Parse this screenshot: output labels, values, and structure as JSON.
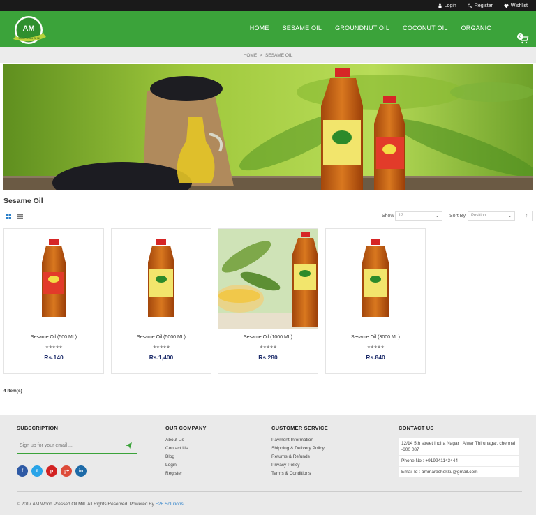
{
  "topbar": {
    "login": "Login",
    "register": "Register",
    "wishlist": "Wishlist"
  },
  "logo": {
    "text": "AM",
    "subtext": "Wood Pressed Oil Mill"
  },
  "nav": [
    {
      "label": "HOME"
    },
    {
      "label": "SESAME OIL"
    },
    {
      "label": "GROUNDNUT OIL"
    },
    {
      "label": "COCONUT OIL"
    },
    {
      "label": "ORGANIC"
    }
  ],
  "cart": {
    "count": "0"
  },
  "breadcrumb": {
    "home": "HOME",
    "separator": ">",
    "current": "SESAME OIL"
  },
  "page_title": "Sesame Oil",
  "toolbar": {
    "show_label": "Show",
    "show_value": "12",
    "sort_label": "Sort By",
    "sort_value": "Position",
    "sort_dir": "↑"
  },
  "products": [
    {
      "name": "Sesame Oil (500 ML)",
      "stars": "★★★★★",
      "price": "Rs.140"
    },
    {
      "name": "Sesame Oil (5000 ML)",
      "stars": "★★★★★",
      "price": "Rs.1,400"
    },
    {
      "name": "Sesame Oil (1000 ML)",
      "stars": "★★★★★",
      "price": "Rs.280"
    },
    {
      "name": "Sesame Oil (3000 ML)",
      "stars": "★★★★★",
      "price": "Rs.840"
    }
  ],
  "item_count": "4 Item(s)",
  "footer": {
    "subscription": {
      "heading": "SUBSCRIPTION",
      "placeholder": "Sign up for your email ..."
    },
    "social": [
      "f",
      "t",
      "p",
      "g+",
      "in"
    ],
    "company": {
      "heading": "OUR COMPANY",
      "links": [
        "About Us",
        "Contact Us",
        "Blog",
        "Login",
        "Register"
      ]
    },
    "service": {
      "heading": "CUSTOMER SERVICE",
      "links": [
        "Payment Information",
        "Shipping & Delivery Policy",
        "Returns & Refunds",
        "Privacy Policy",
        "Terms & Conditions"
      ]
    },
    "contact": {
      "heading": "CONTACT US",
      "address": "12/14 5th street Indira Nagar , Alwar Thirunagar, chennai -600 087",
      "phone": "Phone No : +919941143444",
      "email": "Email Id : ammarachekku@gmail.com"
    },
    "copyright": "© 2017 AM Wood Pressed Oil Mill. All Rights Reserved. Powered By",
    "powered_by": "F2F Solutions"
  },
  "colors": {
    "brand_green": "#3ba33a",
    "topbar": "#1a1a1a",
    "price_navy": "#1e2d6b",
    "footer_bg": "#eaeaea",
    "link_blue": "#2a7fc9"
  }
}
